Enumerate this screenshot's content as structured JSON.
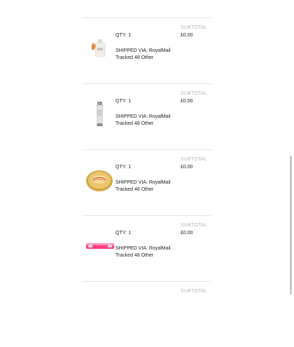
{
  "items": [
    {
      "image_icon": "perfume-bottle-icon",
      "qty_label": "QTY: 1",
      "shipping_line1": "SHIPPED VIA: RoyalMail",
      "shipping_line2": "Tracked 48 Other",
      "subtotal_label": "SUBTOTAL",
      "subtotal_value": "£0.00"
    },
    {
      "image_icon": "tube-icon",
      "qty_label": "QTY: 1",
      "shipping_line1": "SHIPPED VIA: RoyalMail",
      "shipping_line2": "Tracked 48 Other",
      "subtotal_label": "SUBTOTAL",
      "subtotal_value": "£0.00"
    },
    {
      "image_icon": "compact-icon",
      "qty_label": "QTY: 1",
      "shipping_line1": "SHIPPED VIA: RoyalMail",
      "shipping_line2": "Tracked 48 Other",
      "subtotal_label": "SUBTOTAL",
      "subtotal_value": "£0.00"
    },
    {
      "image_icon": "lip-balm-icon",
      "qty_label": "QTY: 1",
      "shipping_line1": "SHIPPED VIA: RoyalMail",
      "shipping_line2": "Tracked 48 Other",
      "subtotal_label": "SUBTOTAL",
      "subtotal_value": "£0.00"
    },
    {
      "subtotal_label": "SUBTOTAL"
    }
  ],
  "colors": {
    "divider": "#e6e6e6",
    "muted_label": "#b5b5b5",
    "text": "#222222"
  }
}
